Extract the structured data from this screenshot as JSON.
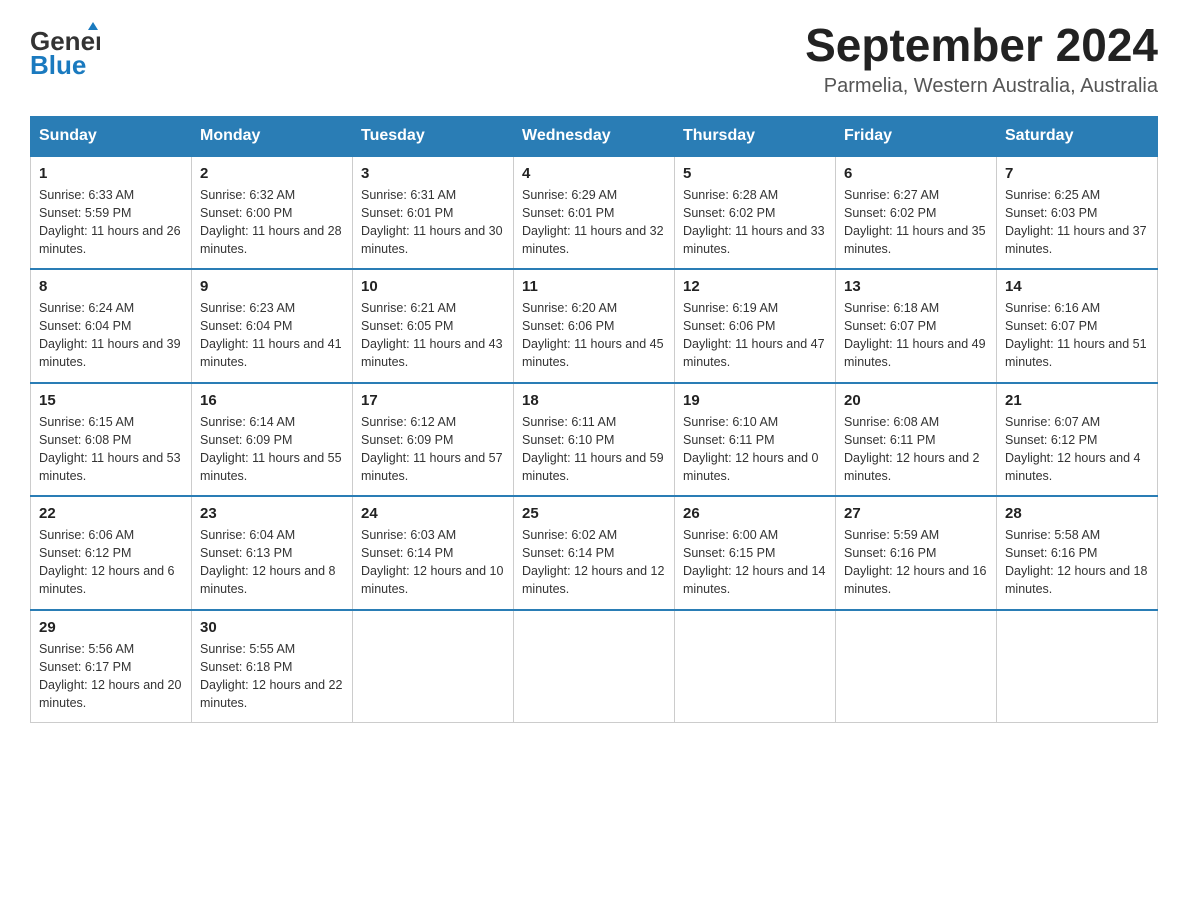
{
  "header": {
    "logo_general": "General",
    "logo_blue": "Blue",
    "title": "September 2024",
    "subtitle": "Parmelia, Western Australia, Australia"
  },
  "columns": [
    "Sunday",
    "Monday",
    "Tuesday",
    "Wednesday",
    "Thursday",
    "Friday",
    "Saturday"
  ],
  "weeks": [
    [
      {
        "day": "1",
        "sunrise": "6:33 AM",
        "sunset": "5:59 PM",
        "daylight": "11 hours and 26 minutes."
      },
      {
        "day": "2",
        "sunrise": "6:32 AM",
        "sunset": "6:00 PM",
        "daylight": "11 hours and 28 minutes."
      },
      {
        "day": "3",
        "sunrise": "6:31 AM",
        "sunset": "6:01 PM",
        "daylight": "11 hours and 30 minutes."
      },
      {
        "day": "4",
        "sunrise": "6:29 AM",
        "sunset": "6:01 PM",
        "daylight": "11 hours and 32 minutes."
      },
      {
        "day": "5",
        "sunrise": "6:28 AM",
        "sunset": "6:02 PM",
        "daylight": "11 hours and 33 minutes."
      },
      {
        "day": "6",
        "sunrise": "6:27 AM",
        "sunset": "6:02 PM",
        "daylight": "11 hours and 35 minutes."
      },
      {
        "day": "7",
        "sunrise": "6:25 AM",
        "sunset": "6:03 PM",
        "daylight": "11 hours and 37 minutes."
      }
    ],
    [
      {
        "day": "8",
        "sunrise": "6:24 AM",
        "sunset": "6:04 PM",
        "daylight": "11 hours and 39 minutes."
      },
      {
        "day": "9",
        "sunrise": "6:23 AM",
        "sunset": "6:04 PM",
        "daylight": "11 hours and 41 minutes."
      },
      {
        "day": "10",
        "sunrise": "6:21 AM",
        "sunset": "6:05 PM",
        "daylight": "11 hours and 43 minutes."
      },
      {
        "day": "11",
        "sunrise": "6:20 AM",
        "sunset": "6:06 PM",
        "daylight": "11 hours and 45 minutes."
      },
      {
        "day": "12",
        "sunrise": "6:19 AM",
        "sunset": "6:06 PM",
        "daylight": "11 hours and 47 minutes."
      },
      {
        "day": "13",
        "sunrise": "6:18 AM",
        "sunset": "6:07 PM",
        "daylight": "11 hours and 49 minutes."
      },
      {
        "day": "14",
        "sunrise": "6:16 AM",
        "sunset": "6:07 PM",
        "daylight": "11 hours and 51 minutes."
      }
    ],
    [
      {
        "day": "15",
        "sunrise": "6:15 AM",
        "sunset": "6:08 PM",
        "daylight": "11 hours and 53 minutes."
      },
      {
        "day": "16",
        "sunrise": "6:14 AM",
        "sunset": "6:09 PM",
        "daylight": "11 hours and 55 minutes."
      },
      {
        "day": "17",
        "sunrise": "6:12 AM",
        "sunset": "6:09 PM",
        "daylight": "11 hours and 57 minutes."
      },
      {
        "day": "18",
        "sunrise": "6:11 AM",
        "sunset": "6:10 PM",
        "daylight": "11 hours and 59 minutes."
      },
      {
        "day": "19",
        "sunrise": "6:10 AM",
        "sunset": "6:11 PM",
        "daylight": "12 hours and 0 minutes."
      },
      {
        "day": "20",
        "sunrise": "6:08 AM",
        "sunset": "6:11 PM",
        "daylight": "12 hours and 2 minutes."
      },
      {
        "day": "21",
        "sunrise": "6:07 AM",
        "sunset": "6:12 PM",
        "daylight": "12 hours and 4 minutes."
      }
    ],
    [
      {
        "day": "22",
        "sunrise": "6:06 AM",
        "sunset": "6:12 PM",
        "daylight": "12 hours and 6 minutes."
      },
      {
        "day": "23",
        "sunrise": "6:04 AM",
        "sunset": "6:13 PM",
        "daylight": "12 hours and 8 minutes."
      },
      {
        "day": "24",
        "sunrise": "6:03 AM",
        "sunset": "6:14 PM",
        "daylight": "12 hours and 10 minutes."
      },
      {
        "day": "25",
        "sunrise": "6:02 AM",
        "sunset": "6:14 PM",
        "daylight": "12 hours and 12 minutes."
      },
      {
        "day": "26",
        "sunrise": "6:00 AM",
        "sunset": "6:15 PM",
        "daylight": "12 hours and 14 minutes."
      },
      {
        "day": "27",
        "sunrise": "5:59 AM",
        "sunset": "6:16 PM",
        "daylight": "12 hours and 16 minutes."
      },
      {
        "day": "28",
        "sunrise": "5:58 AM",
        "sunset": "6:16 PM",
        "daylight": "12 hours and 18 minutes."
      }
    ],
    [
      {
        "day": "29",
        "sunrise": "5:56 AM",
        "sunset": "6:17 PM",
        "daylight": "12 hours and 20 minutes."
      },
      {
        "day": "30",
        "sunrise": "5:55 AM",
        "sunset": "6:18 PM",
        "daylight": "12 hours and 22 minutes."
      },
      null,
      null,
      null,
      null,
      null
    ]
  ]
}
